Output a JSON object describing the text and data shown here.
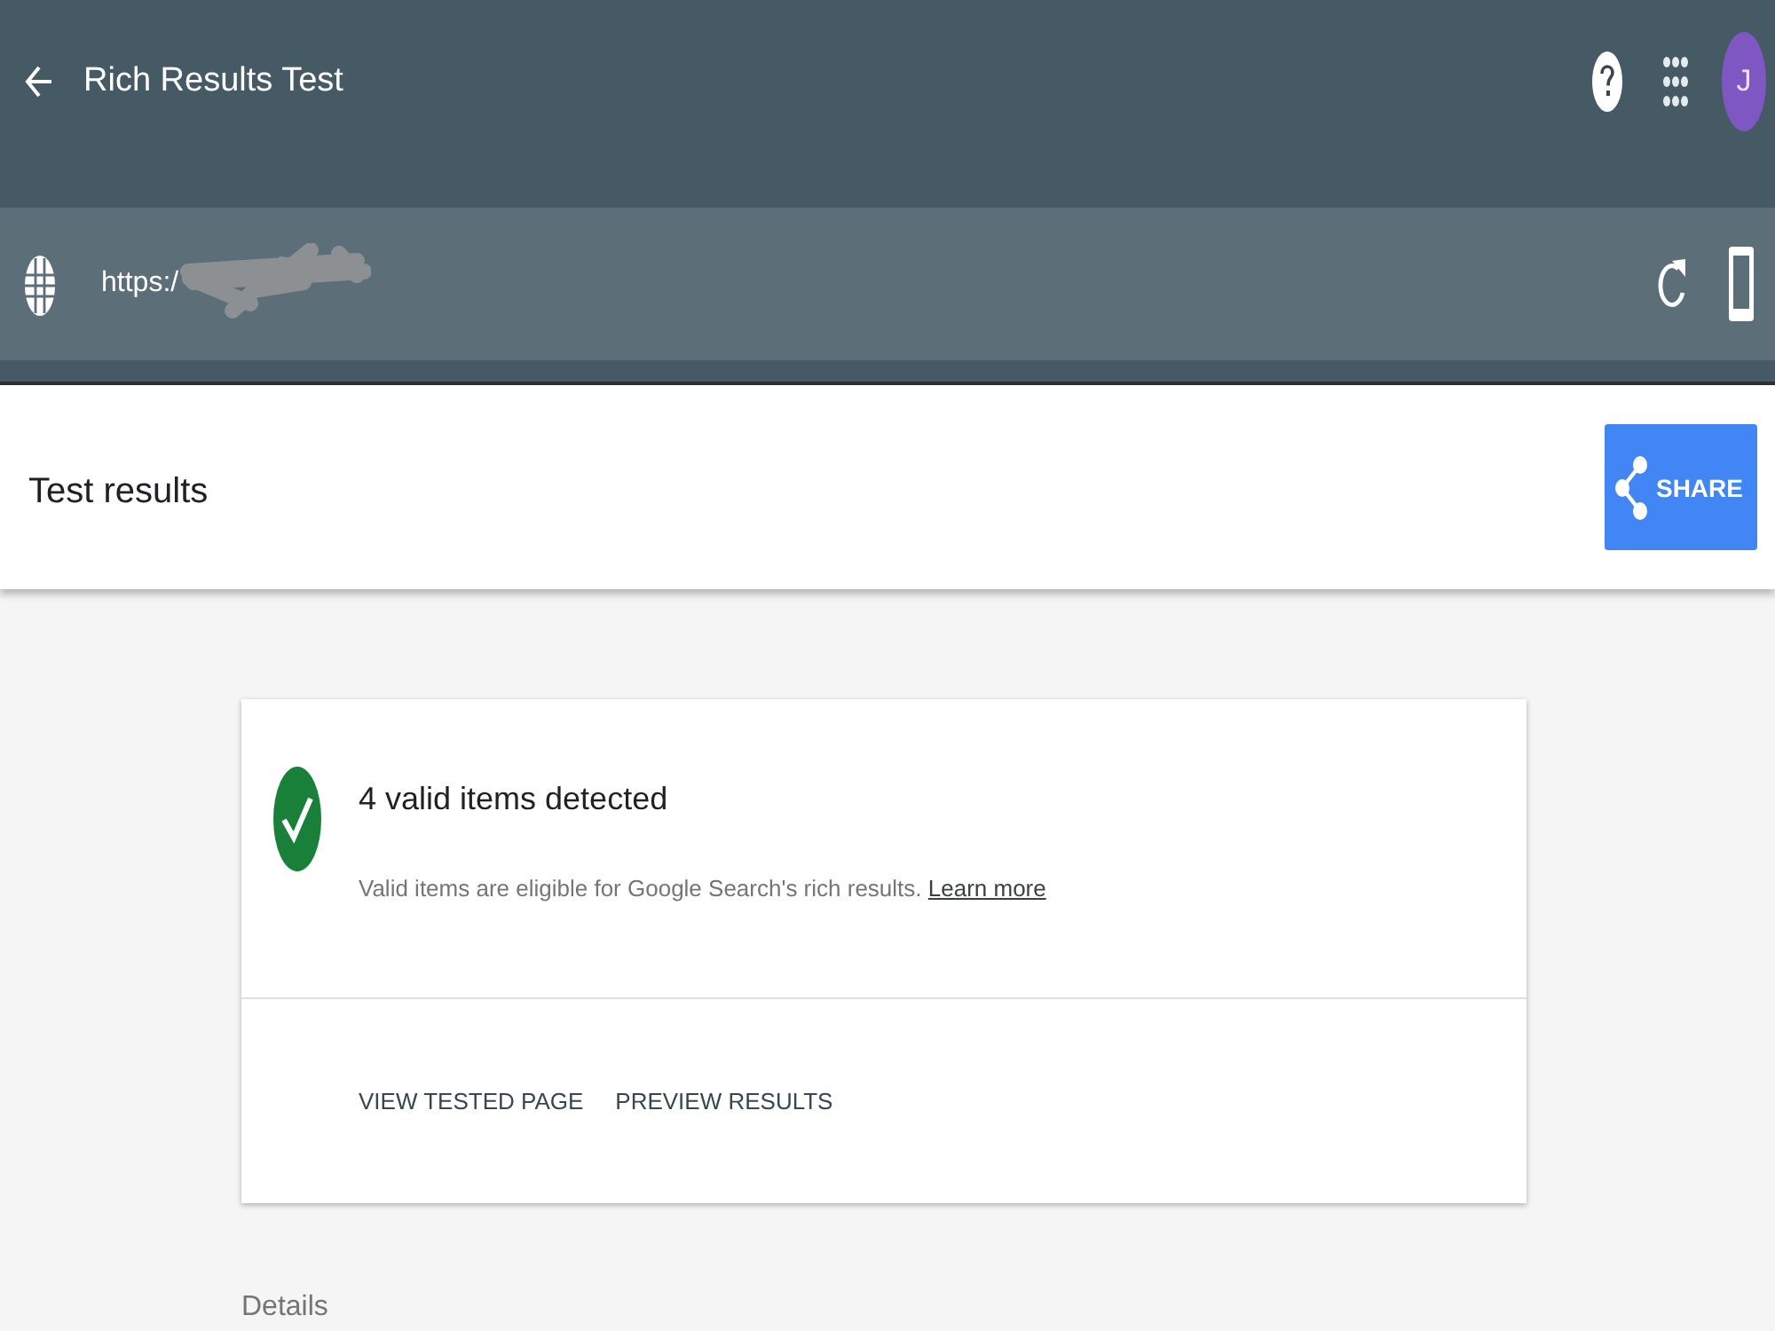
{
  "header": {
    "title": "Rich Results Test",
    "avatar_initial": "J"
  },
  "url_bar": {
    "value": "https:/",
    "redacted": true
  },
  "results_bar": {
    "title": "Test results",
    "share_button": "SHARE"
  },
  "summary_card": {
    "valid": true,
    "title": "4 valid items detected",
    "description": "Valid items are eligible for Google Search's rich results.",
    "link": "Learn more",
    "actions": [
      "VIEW TESTED PAGE",
      "PREVIEW RESULTS"
    ]
  },
  "details_label": "Details"
}
